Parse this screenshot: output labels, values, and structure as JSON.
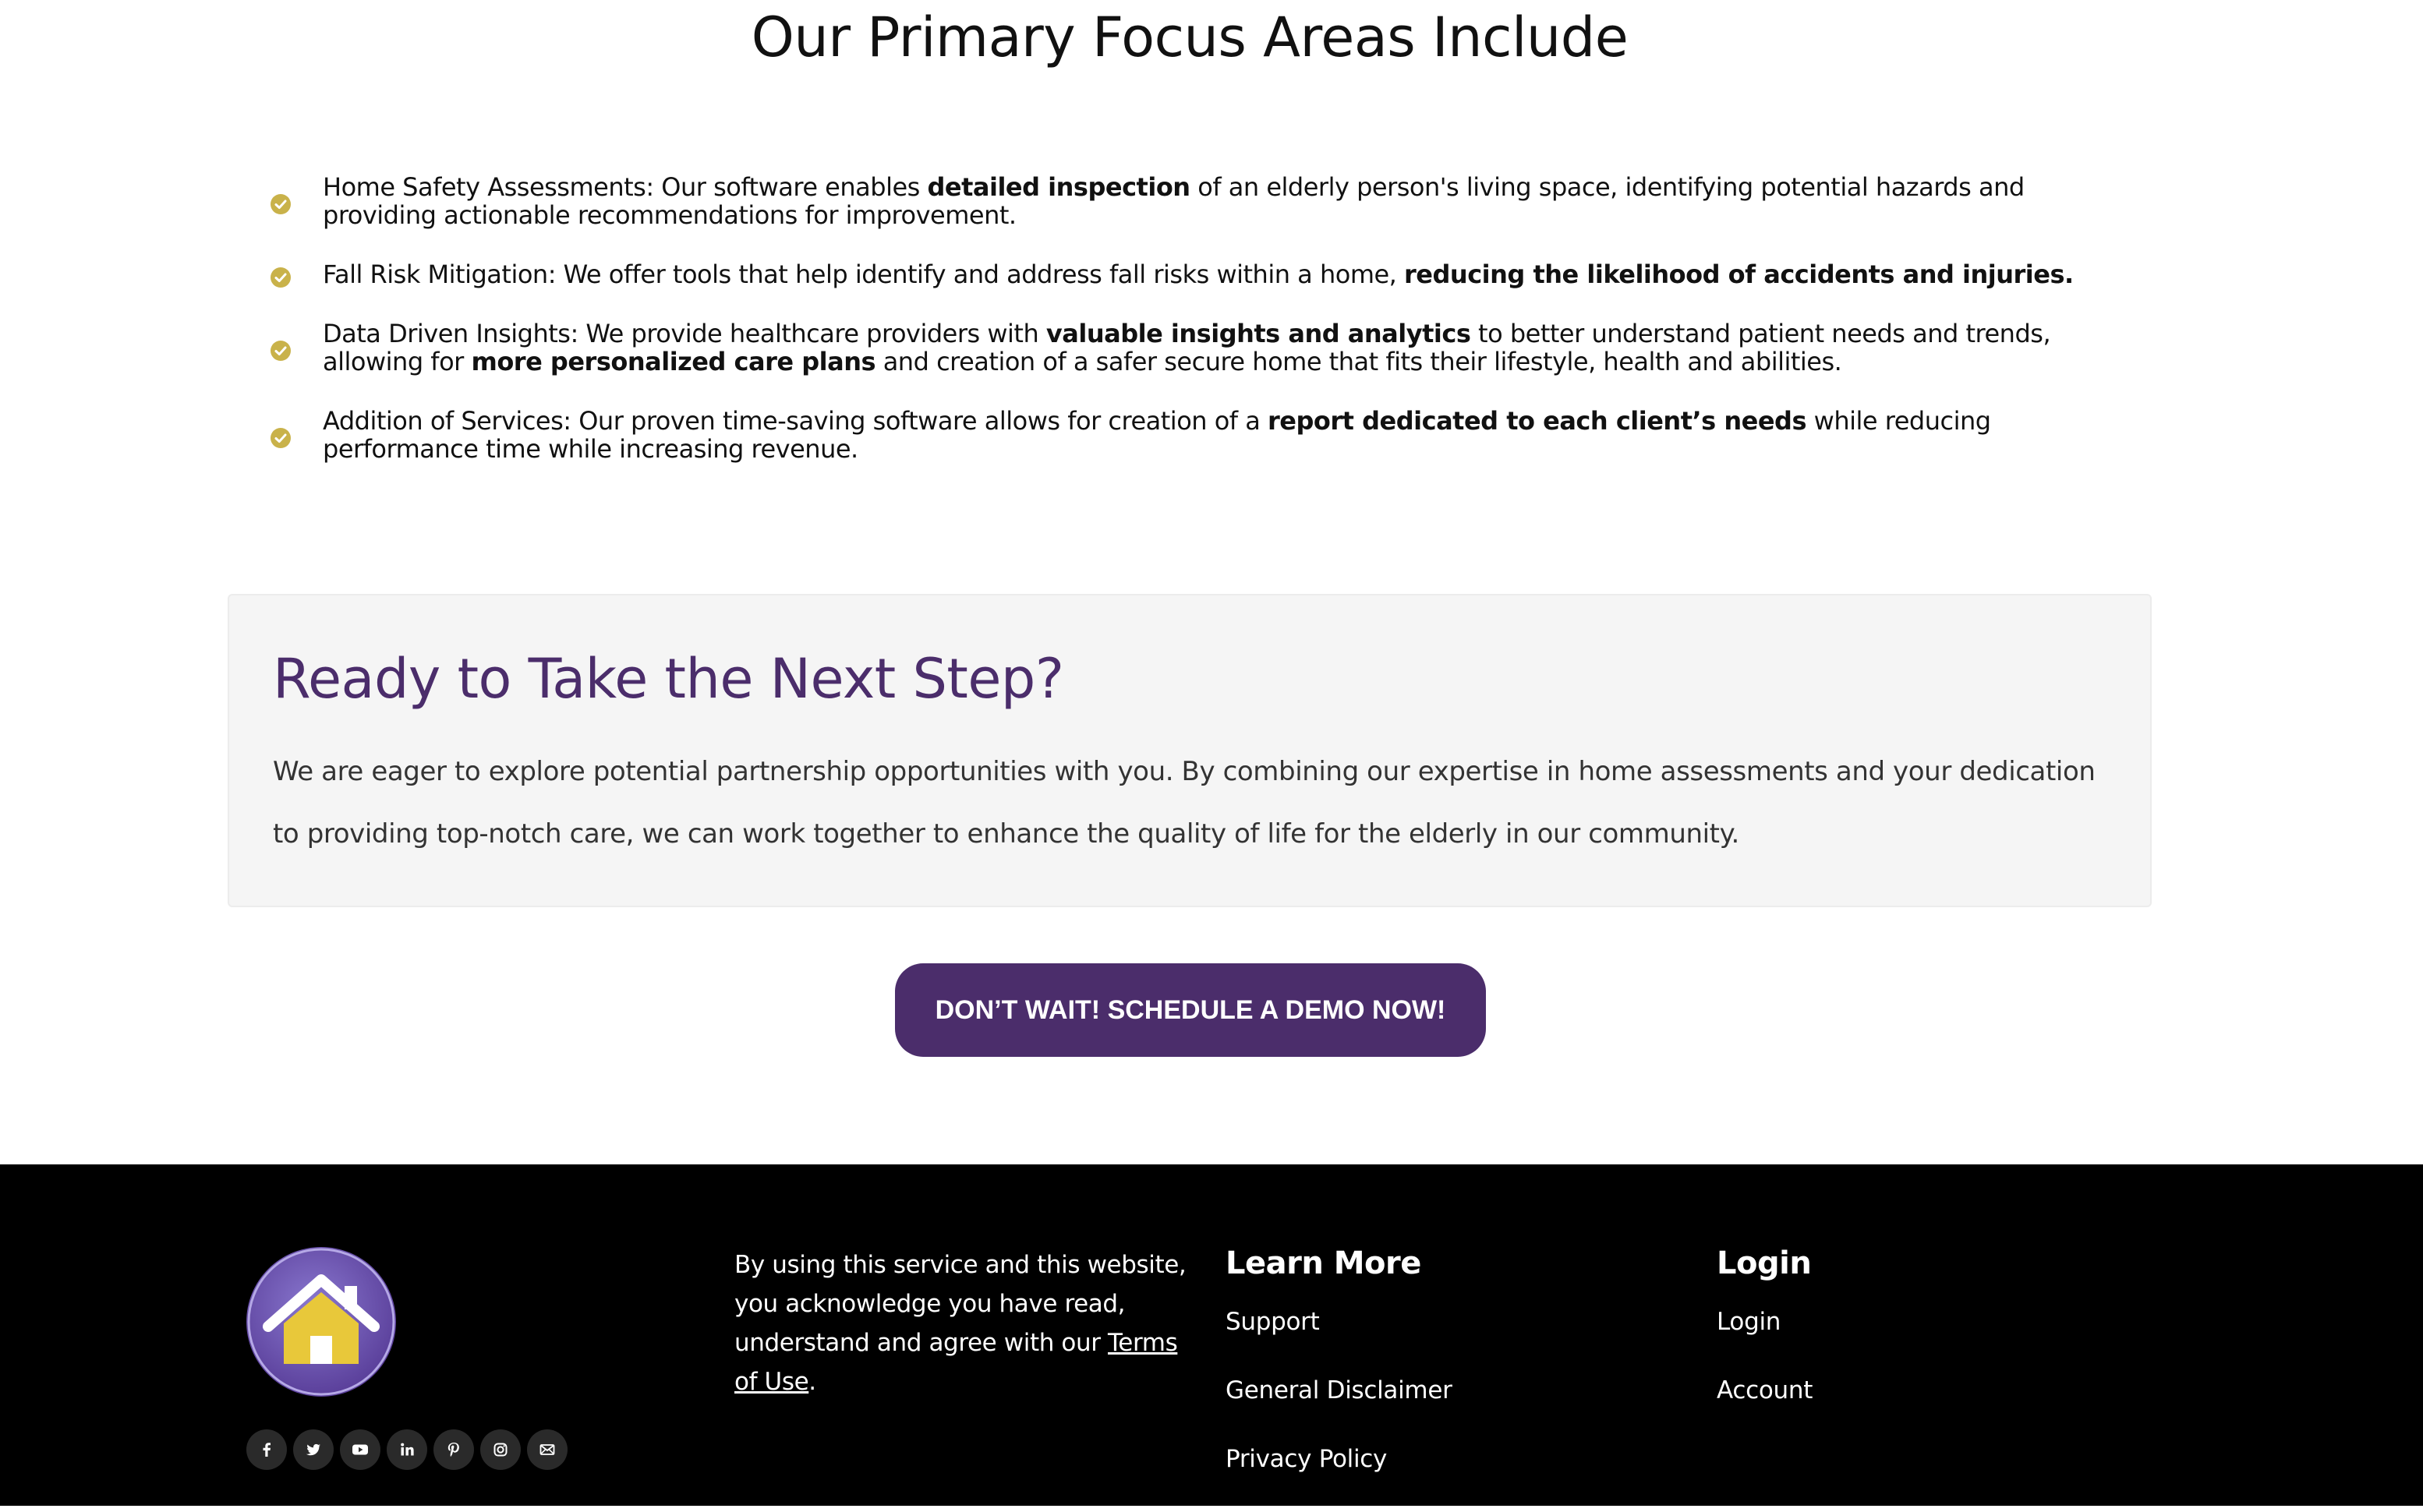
{
  "focus": {
    "title": "Our Primary Focus Areas Include",
    "items": [
      {
        "lead": "Home Safety Assessments: Our software enables ",
        "bold1": "detailed inspection",
        "mid": " of an elderly person's living space, identifying potential hazards and providing actionable recommendations for improvement.",
        "bold2": "",
        "tail": ""
      },
      {
        "lead": "Fall Risk Mitigation: We offer tools that help identify and address fall risks within a home, ",
        "bold1": "reducing the likelihood of accidents and injuries.",
        "mid": "",
        "bold2": "",
        "tail": ""
      },
      {
        "lead": "Data Driven Insights: We provide healthcare providers with ",
        "bold1": "valuable insights and analytics",
        "mid": " to better understand patient needs and trends, allowing for ",
        "bold2": "more personalized care plans",
        "tail": " and creation of a safer secure home that fits their lifestyle, health and abilities."
      },
      {
        "lead": "Addition of Services: Our proven time-saving software allows for creation of a ",
        "bold1": "report dedicated to each client’s needs",
        "mid": " while reducing performance time while increasing revenue.",
        "bold2": "",
        "tail": ""
      }
    ],
    "check_icon": "check-circle-icon",
    "check_color": "#c9b24a"
  },
  "cta": {
    "title": "Ready to Take the Next Step?",
    "text": "We are eager to explore potential partnership opportunities with you. By combining our expertise in home assessments and your dedication to providing top-notch care, we can work together to enhance the quality of life for the elderly in our community.",
    "title_color": "#4b2d6b",
    "button_label": "DON’T WAIT! SCHEDULE A DEMO NOW!",
    "button_color": "#4b2d6b"
  },
  "footer": {
    "logo_icon": "house-logo-icon",
    "social_icons": [
      "facebook-icon",
      "twitter-icon",
      "youtube-icon",
      "linkedin-icon",
      "pinterest-icon",
      "instagram-icon",
      "mail-icon"
    ],
    "terms_pre": "By using this service and this website, you acknowledge you have read, understand and agree with our ",
    "terms_link": "Terms of Use",
    "terms_post": ".",
    "learn_more": {
      "heading": "Learn More",
      "links": [
        "Support",
        "General Disclaimer",
        "Privacy Policy"
      ]
    },
    "login": {
      "heading": "Login",
      "links": [
        "Login",
        "Account"
      ]
    }
  }
}
